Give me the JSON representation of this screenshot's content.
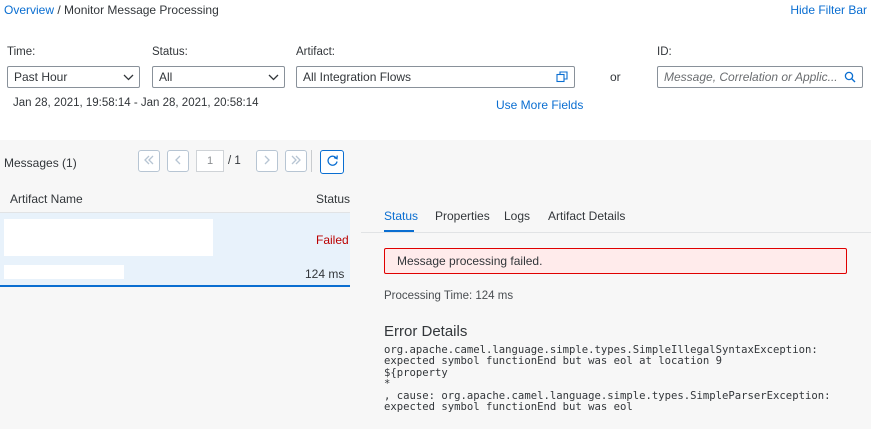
{
  "breadcrumb": {
    "link": "Overview",
    "separator": "/",
    "current": "Monitor Message Processing"
  },
  "hide_filter_bar": "Hide Filter Bar",
  "filters": {
    "time": {
      "label": "Time:",
      "value": "Past Hour"
    },
    "status": {
      "label": "Status:",
      "value": "All"
    },
    "artifact": {
      "label": "Artifact:",
      "value": "All Integration Flows"
    },
    "or_text": "or",
    "id": {
      "label": "ID:",
      "placeholder": "Message, Correlation or Applic..."
    },
    "date_range": "Jan 28, 2021, 19:58:14 - Jan 28, 2021, 20:58:14",
    "use_more_fields": "Use More Fields"
  },
  "messages": {
    "title": "Messages (1)",
    "page": "1",
    "page_total": "/ 1",
    "columns": {
      "name": "Artifact Name",
      "status": "Status"
    },
    "rows": [
      {
        "status": "Failed",
        "duration": "124 ms"
      }
    ]
  },
  "details": {
    "tabs": [
      "Status",
      "Properties",
      "Logs",
      "Artifact Details"
    ],
    "active_tab": "Status",
    "error_strip": "Message processing failed.",
    "processing_time": "Processing Time: 124 ms",
    "error_title": "Error Details",
    "error_text": "org.apache.camel.language.simple.types.SimpleIllegalSyntaxException:\nexpected symbol functionEnd but was eol at location 9\n${property\n*\n, cause: org.apache.camel.language.simple.types.SimpleParserException:\nexpected symbol functionEnd but was eol"
  },
  "icons": {
    "chevron": "chevron-down-icon",
    "value_help": "value-help-icon",
    "search": "search-icon",
    "first": "first-page-icon",
    "prev": "previous-page-icon",
    "next": "next-page-icon",
    "last": "last-page-icon",
    "refresh": "refresh-icon"
  },
  "colors": {
    "accent": "#0a6ed1",
    "error": "#bb0000",
    "error_bg": "#ffebeb",
    "selected_row": "#e8f2fb"
  }
}
